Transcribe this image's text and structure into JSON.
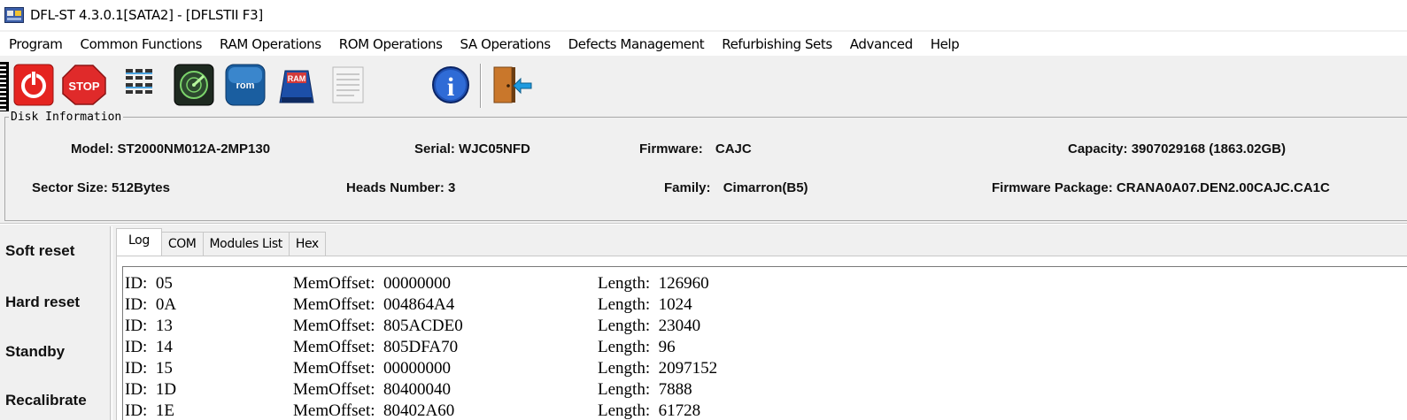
{
  "window": {
    "title": "DFL-ST 4.3.0.1[SATA2] - [DFLSTII  F3]",
    "icon": "dfl-app-icon"
  },
  "menu": [
    "Program",
    "Common Functions",
    "RAM Operations",
    "ROM Operations",
    "SA Operations",
    "Defects Management",
    "Refurbishing Sets",
    "Advanced",
    "Help"
  ],
  "toolbar": {
    "stop_label": "STOP",
    "rom_label": "rom",
    "ram_label": "RAM",
    "info_label": "i",
    "icons": [
      "power-icon",
      "stop-icon",
      "grid-icon",
      "radar-icon",
      "rom-icon",
      "ram-icon",
      "notepad-icon",
      "info-icon",
      "exit-icon"
    ]
  },
  "disk_info": {
    "legend": "Disk Information",
    "model_label": "Model:",
    "model": "ST2000NM012A-2MP130",
    "serial_label": "Serial:",
    "serial": "WJC05NFD",
    "firmware_label": "Firmware:",
    "firmware": "CAJC",
    "capacity_label": "Capacity:",
    "capacity": "3907029168 (1863.02GB)",
    "sector_label": "Sector Size:",
    "sector": "512Bytes",
    "heads_label": "Heads Number:",
    "heads": "3",
    "family_label": "Family:",
    "family": "Cimarron(B5)",
    "package_label": "Firmware Package:",
    "package": "CRANA0A07.DEN2.00CAJC.CA1C"
  },
  "side_actions": [
    "Soft reset",
    "Hard reset",
    "Standby",
    "Recalibrate"
  ],
  "tabs": [
    "Log",
    "COM",
    "Modules List",
    "Hex"
  ],
  "active_tab": "Log",
  "log": [
    {
      "id": "ID:  05",
      "offset": "MemOffset:  00000000",
      "length": "Length:  126960"
    },
    {
      "id": "ID:  0A",
      "offset": "MemOffset:  004864A4",
      "length": "Length:  1024"
    },
    {
      "id": "ID:  13",
      "offset": "MemOffset:  805ACDE0",
      "length": "Length:  23040"
    },
    {
      "id": "ID:  14",
      "offset": "MemOffset:  805DFA70",
      "length": "Length:  96"
    },
    {
      "id": "ID:  15",
      "offset": "MemOffset:  00000000",
      "length": "Length:  2097152"
    },
    {
      "id": "ID:  1D",
      "offset": "MemOffset:  80400040",
      "length": "Length:  7888"
    },
    {
      "id": "ID:  1E",
      "offset": "MemOffset:  80402A60",
      "length": "Length:  61728"
    }
  ]
}
